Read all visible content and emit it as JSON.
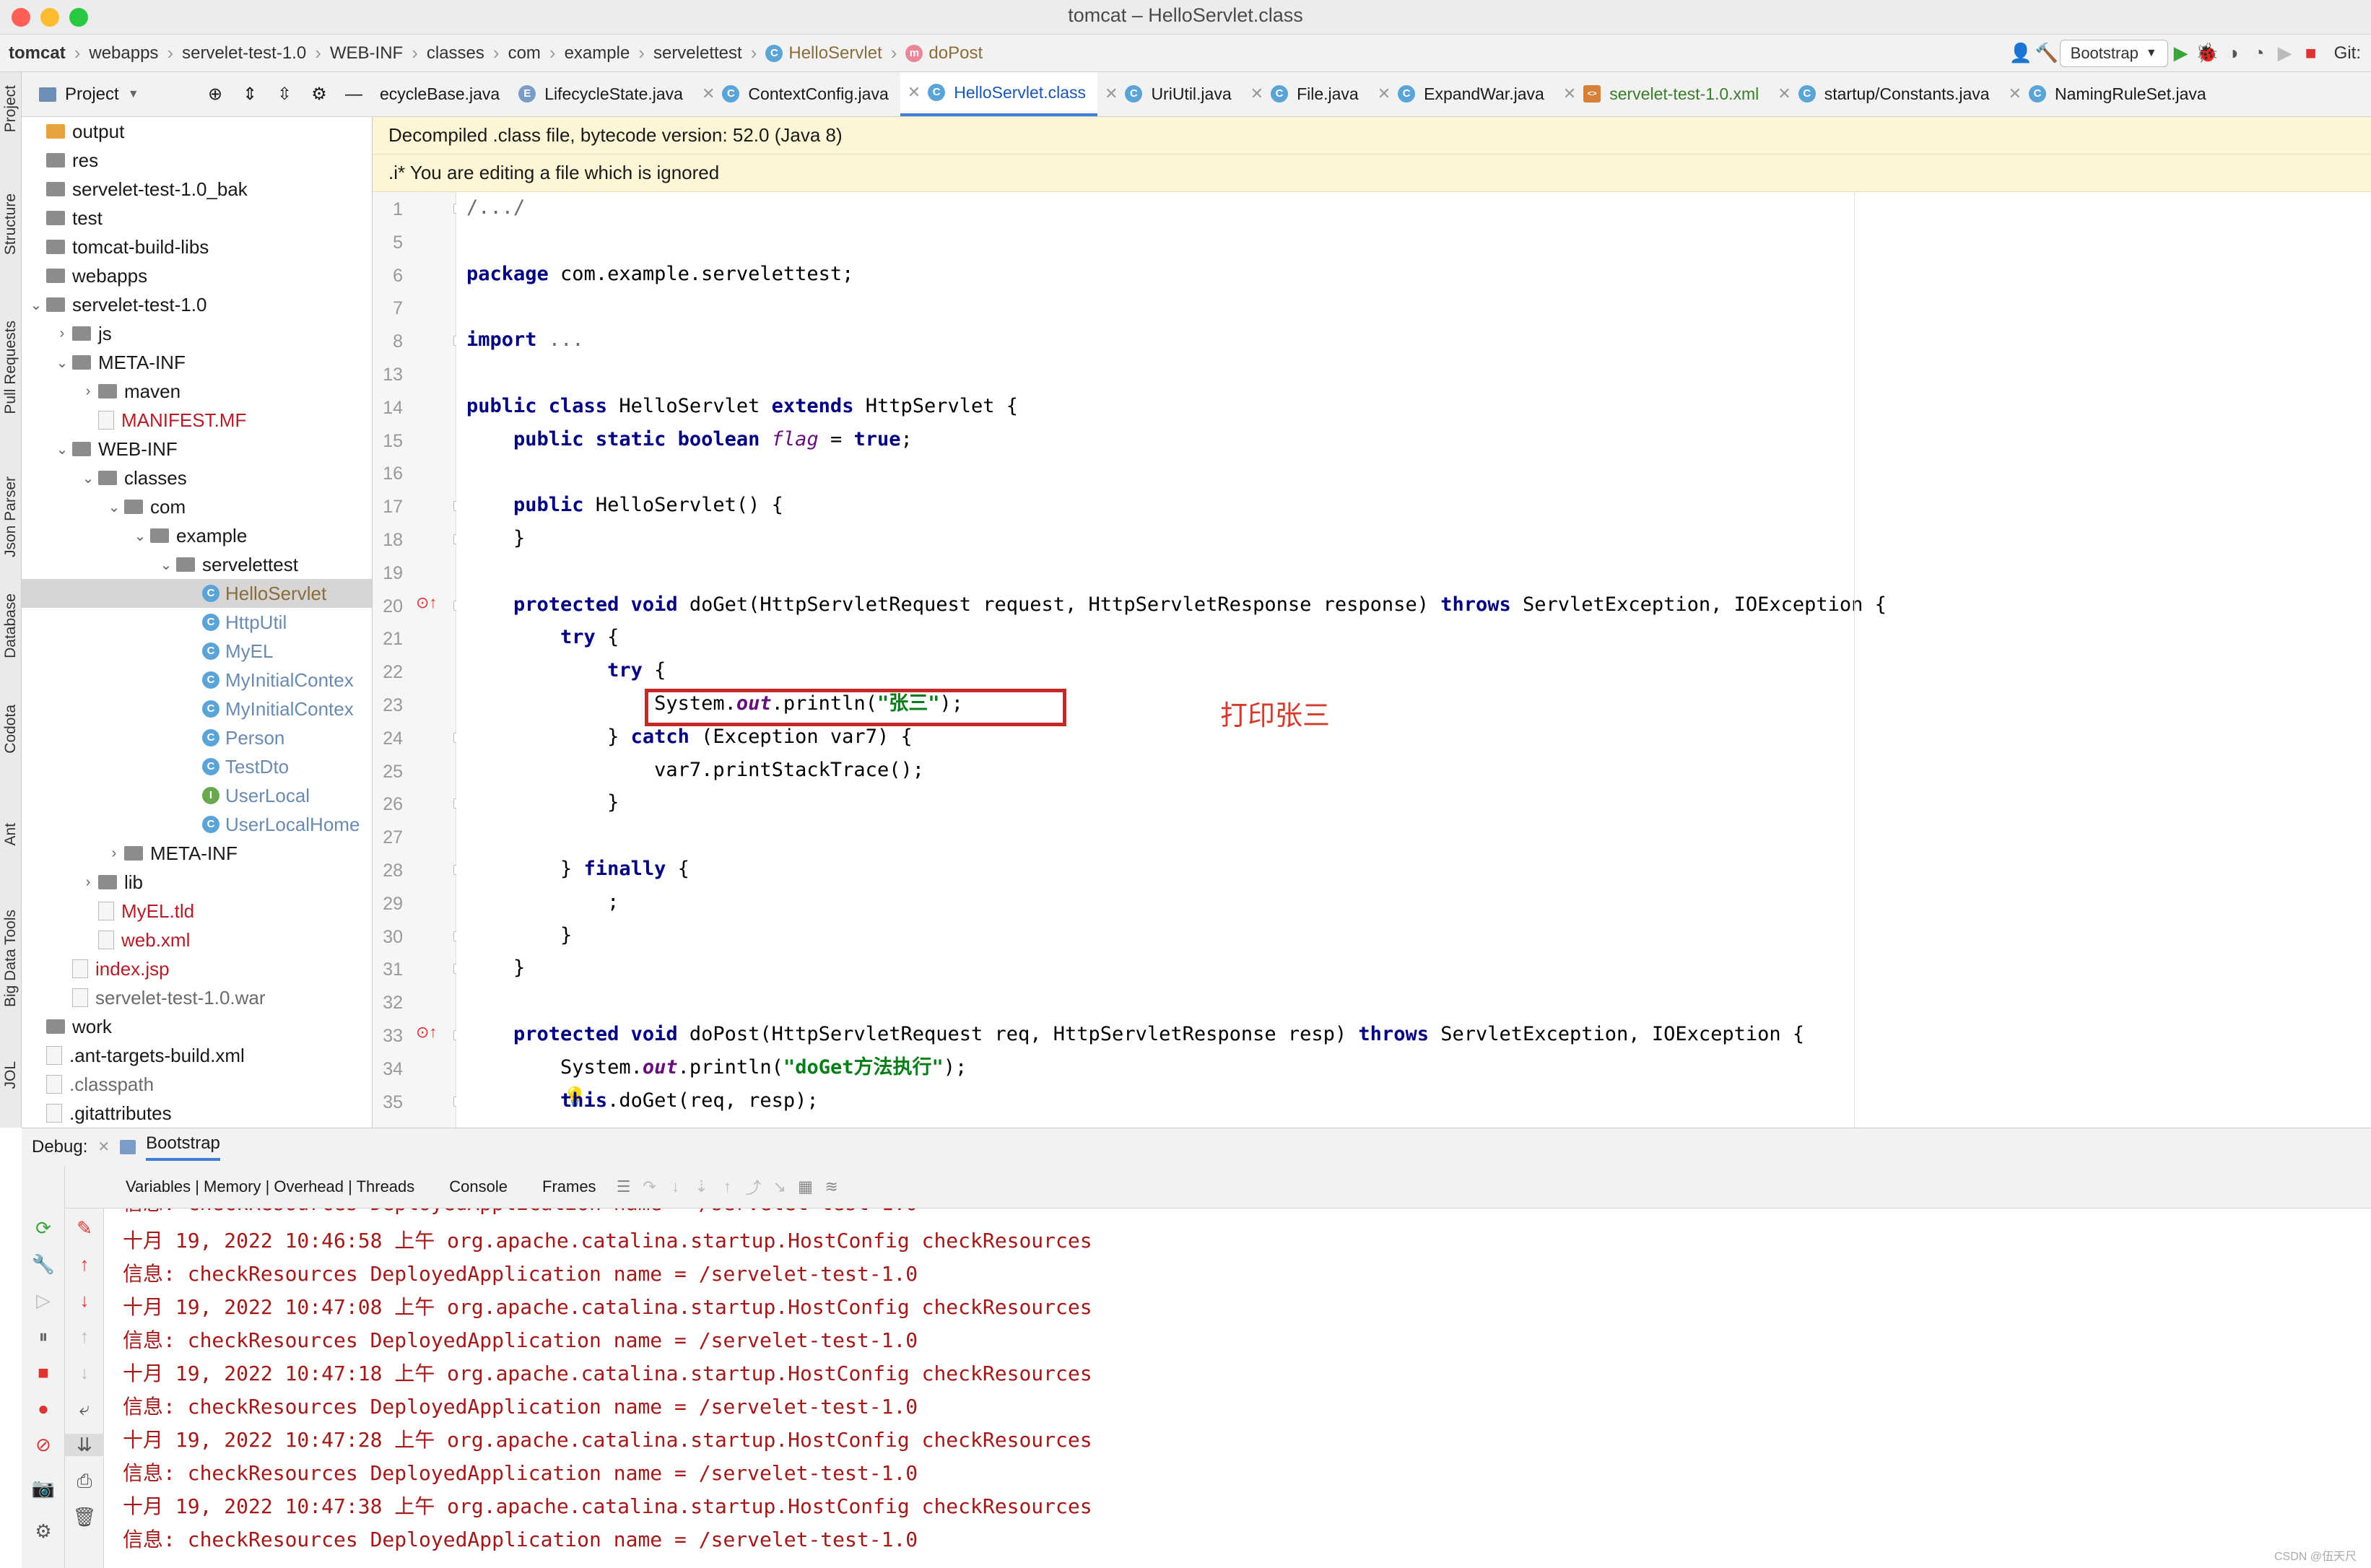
{
  "window": {
    "title": "tomcat – HelloServlet.class"
  },
  "breadcrumb": [
    "tomcat",
    "webapps",
    "servelet-test-1.0",
    "WEB-INF",
    "classes",
    "com",
    "example",
    "servelettest",
    "HelloServlet",
    "doPost"
  ],
  "toolbar": {
    "run_config": "Bootstrap",
    "git_label": "Git:"
  },
  "tool_windows_left": [
    "Project",
    "Structure",
    "Pull Requests",
    "Json Parser",
    "Database",
    "Codota",
    "Ant",
    "Big Data Tools",
    "JOL"
  ],
  "project_panel": {
    "title": "Project"
  },
  "tree": [
    {
      "label": "output",
      "kind": "folder-orange",
      "depth": 0,
      "chev": ""
    },
    {
      "label": "res",
      "kind": "folder",
      "depth": 0,
      "chev": ""
    },
    {
      "label": "servelet-test-1.0_bak",
      "kind": "folder",
      "depth": 0,
      "chev": ""
    },
    {
      "label": "test",
      "kind": "folder",
      "depth": 0,
      "chev": ""
    },
    {
      "label": "tomcat-build-libs",
      "kind": "folder",
      "depth": 0,
      "chev": ""
    },
    {
      "label": "webapps",
      "kind": "folder",
      "depth": 0,
      "chev": ""
    },
    {
      "label": "servelet-test-1.0",
      "kind": "folder",
      "depth": 0,
      "chev": "v"
    },
    {
      "label": "js",
      "kind": "folder",
      "depth": 1,
      "chev": ">"
    },
    {
      "label": "META-INF",
      "kind": "folder",
      "depth": 1,
      "chev": "v"
    },
    {
      "label": "maven",
      "kind": "folder",
      "depth": 2,
      "chev": ">"
    },
    {
      "label": "MANIFEST.MF",
      "kind": "file-red",
      "depth": 2,
      "chev": ""
    },
    {
      "label": "WEB-INF",
      "kind": "folder",
      "depth": 1,
      "chev": "v"
    },
    {
      "label": "classes",
      "kind": "folder",
      "depth": 2,
      "chev": "v"
    },
    {
      "label": "com",
      "kind": "folder",
      "depth": 3,
      "chev": "v"
    },
    {
      "label": "example",
      "kind": "folder",
      "depth": 4,
      "chev": "v"
    },
    {
      "label": "servelettest",
      "kind": "folder",
      "depth": 5,
      "chev": "v"
    },
    {
      "label": "HelloServlet",
      "kind": "class",
      "depth": 6,
      "chev": "",
      "selected": true
    },
    {
      "label": "HttpUtil",
      "kind": "class",
      "depth": 6,
      "chev": ""
    },
    {
      "label": "MyEL",
      "kind": "class",
      "depth": 6,
      "chev": ""
    },
    {
      "label": "MyInitialContex",
      "kind": "class",
      "depth": 6,
      "chev": ""
    },
    {
      "label": "MyInitialContex",
      "kind": "class",
      "depth": 6,
      "chev": ""
    },
    {
      "label": "Person",
      "kind": "class",
      "depth": 6,
      "chev": ""
    },
    {
      "label": "TestDto",
      "kind": "class",
      "depth": 6,
      "chev": ""
    },
    {
      "label": "UserLocal",
      "kind": "interface",
      "depth": 6,
      "chev": ""
    },
    {
      "label": "UserLocalHome",
      "kind": "class",
      "depth": 6,
      "chev": ""
    },
    {
      "label": "META-INF",
      "kind": "folder",
      "depth": 3,
      "chev": ">"
    },
    {
      "label": "lib",
      "kind": "folder",
      "depth": 2,
      "chev": ">"
    },
    {
      "label": "MyEL.tld",
      "kind": "file-red",
      "depth": 2,
      "chev": ""
    },
    {
      "label": "web.xml",
      "kind": "file-red",
      "depth": 2,
      "chev": ""
    },
    {
      "label": "index.jsp",
      "kind": "file-red",
      "depth": 1,
      "chev": ""
    },
    {
      "label": "servelet-test-1.0.war",
      "kind": "file-grey",
      "depth": 1,
      "chev": ""
    },
    {
      "label": "work",
      "kind": "folder",
      "depth": 0,
      "chev": ""
    },
    {
      "label": ".ant-targets-build.xml",
      "kind": "file",
      "depth": 0,
      "chev": ""
    },
    {
      "label": ".classpath",
      "kind": "file-grey",
      "depth": 0,
      "chev": ""
    },
    {
      "label": ".gitattributes",
      "kind": "file",
      "depth": 0,
      "chev": ""
    }
  ],
  "editor_tabs": [
    {
      "label": "ecycleBase.java",
      "icon": "",
      "close": false,
      "active": false
    },
    {
      "label": "LifecycleState.java",
      "icon": "E",
      "close": false,
      "active": false
    },
    {
      "label": "ContextConfig.java",
      "icon": "C",
      "close": true,
      "active": false
    },
    {
      "label": "HelloServlet.class",
      "icon": "C",
      "close": true,
      "active": true
    },
    {
      "label": "UriUtil.java",
      "icon": "C",
      "close": true,
      "active": false
    },
    {
      "label": "File.java",
      "icon": "C",
      "close": true,
      "active": false
    },
    {
      "label": "ExpandWar.java",
      "icon": "C",
      "close": true,
      "active": false
    },
    {
      "label": "servelet-test-1.0.xml",
      "icon": "X",
      "close": true,
      "active": false
    },
    {
      "label": "startup/Constants.java",
      "icon": "C",
      "close": true,
      "active": false
    },
    {
      "label": "NamingRuleSet.java",
      "icon": "C",
      "close": true,
      "active": false
    }
  ],
  "banners": {
    "decompiled": "Decompiled .class file, bytecode version: 52.0 (Java 8)",
    "ignored": ".i* You are editing a file which is ignored"
  },
  "code_lines": [
    {
      "n": "1",
      "html": "<span class=\"grey\">/.../</span>"
    },
    {
      "n": "5",
      "html": ""
    },
    {
      "n": "6",
      "html": "<span class=\"kw\">package</span> com.example.servelettest;"
    },
    {
      "n": "7",
      "html": ""
    },
    {
      "n": "8",
      "html": "<span class=\"kw\">import</span> <span class=\"grey\">...</span>"
    },
    {
      "n": "13",
      "html": ""
    },
    {
      "n": "14",
      "html": "<span class=\"kw\">public class</span> HelloServlet <span class=\"kw\">extends</span> HttpServlet {"
    },
    {
      "n": "15",
      "html": "    <span class=\"kw\">public static boolean</span> <span class=\"fi\" style=\"font-weight:normal\">flag</span> = <span class=\"kw\">true</span>;"
    },
    {
      "n": "16",
      "html": ""
    },
    {
      "n": "17",
      "html": "    <span class=\"kw\">public</span> HelloServlet() {"
    },
    {
      "n": "18",
      "html": "    }"
    },
    {
      "n": "19",
      "html": ""
    },
    {
      "n": "20",
      "html": "    <span class=\"kw\">protected void</span> doGet(HttpServletRequest request, HttpServletResponse response) <span class=\"kw\">throws</span> ServletException, IOException {"
    },
    {
      "n": "21",
      "html": "        <span class=\"kw\">try</span> {"
    },
    {
      "n": "22",
      "html": "            <span class=\"kw\">try</span> {"
    },
    {
      "n": "23",
      "html": "                System.<span class=\"fi\">out</span>.println(<span class=\"st\">\"张三\"</span>);"
    },
    {
      "n": "24",
      "html": "            } <span class=\"kw\">catch</span> (Exception var7) {"
    },
    {
      "n": "25",
      "html": "                var7.printStackTrace();"
    },
    {
      "n": "26",
      "html": "            }"
    },
    {
      "n": "27",
      "html": ""
    },
    {
      "n": "28",
      "html": "        } <span class=\"kw\">finally</span> {"
    },
    {
      "n": "29",
      "html": "            ;"
    },
    {
      "n": "30",
      "html": "        }"
    },
    {
      "n": "31",
      "html": "    }"
    },
    {
      "n": "32",
      "html": ""
    },
    {
      "n": "33",
      "html": "    <span class=\"kw\">protected void</span> doPost(HttpServletRequest req, HttpServletResponse resp) <span class=\"kw\">throws</span> ServletException, IOException {"
    },
    {
      "n": "34",
      "html": "        System.<span class=\"fi\">out</span>.println(<span class=\"st\">\"doGet方法执行\"</span>);"
    },
    {
      "n": "35",
      "html": "        <span class=\"kw\">this</span>.doGet(req, resp);"
    }
  ],
  "annotation": "打印张三",
  "debug": {
    "label": "Debug:",
    "session": "Bootstrap",
    "tabs": [
      "Variables | Memory | Overhead | Threads",
      "Console",
      "Frames"
    ]
  },
  "console_lines": [
    "十月 19, 2022 10:46:58 上午 org.apache.catalina.startup.HostConfig checkResources",
    "信息: checkResources DeployedApplication name = /servelet-test-1.0",
    "十月 19, 2022 10:47:08 上午 org.apache.catalina.startup.HostConfig checkResources",
    "信息: checkResources DeployedApplication name = /servelet-test-1.0",
    "十月 19, 2022 10:47:18 上午 org.apache.catalina.startup.HostConfig checkResources",
    "信息: checkResources DeployedApplication name = /servelet-test-1.0",
    "十月 19, 2022 10:47:28 上午 org.apache.catalina.startup.HostConfig checkResources",
    "信息: checkResources DeployedApplication name = /servelet-test-1.0",
    "十月 19, 2022 10:47:38 上午 org.apache.catalina.startup.HostConfig checkResources",
    "信息: checkResources DeployedApplication name = /servelet-test-1.0"
  ],
  "watermark": "CSDN @伍天尺"
}
